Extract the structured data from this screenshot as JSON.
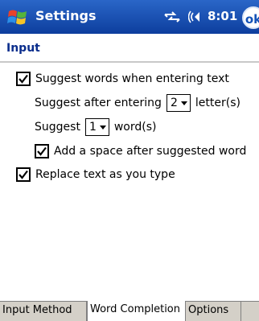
{
  "titlebar": {
    "app_title": "Settings",
    "time": "8:01",
    "ok_label": "ok"
  },
  "page": {
    "title": "Input"
  },
  "options": {
    "suggest_words": {
      "label": "Suggest words when entering text",
      "checked": true
    },
    "suggest_after": {
      "prefix": "Suggest after entering",
      "value": "2",
      "suffix": "letter(s)"
    },
    "suggest_count": {
      "prefix": "Suggest",
      "value": "1",
      "suffix": "word(s)"
    },
    "add_space": {
      "label": "Add a space after suggested word",
      "checked": true
    },
    "replace_text": {
      "label": "Replace text as you type",
      "checked": true
    }
  },
  "tabs": [
    {
      "label": "Input Method",
      "active": false
    },
    {
      "label": "Word Completion",
      "active": true
    },
    {
      "label": "Options",
      "active": false
    }
  ],
  "icons": {
    "start": "windows-start-icon",
    "signal": "connectivity-icon",
    "speaker": "speaker-icon"
  }
}
